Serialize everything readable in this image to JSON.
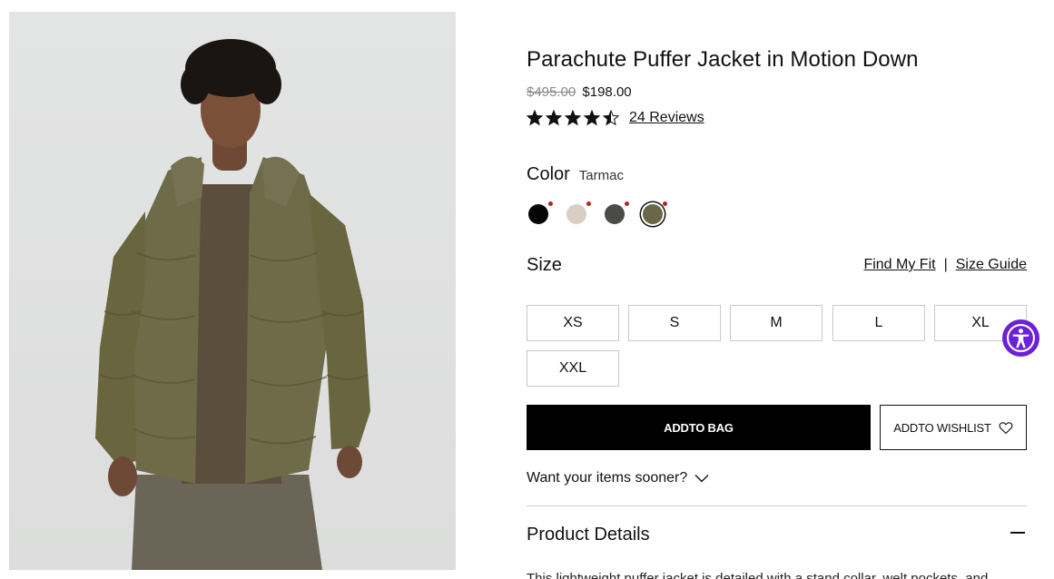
{
  "product": {
    "title": "Parachute Puffer Jacket in Motion Down",
    "price_original": "$495.00",
    "price_sale": "$198.00",
    "rating": 4.5,
    "reviews_label": "24 Reviews",
    "image_icon": "product-photo"
  },
  "color": {
    "label": "Color",
    "selected_name": "Tarmac",
    "swatches": [
      {
        "color": "#050505"
      },
      {
        "color": "#d8cfc2"
      },
      {
        "color": "#4a4a48"
      },
      {
        "color": "#6a6648"
      }
    ],
    "dot_color": "#b3261e"
  },
  "size": {
    "label": "Size",
    "find_fit": "Find My Fit",
    "separator": "|",
    "size_guide": "Size Guide",
    "options": [
      "XS",
      "S",
      "M",
      "L",
      "XL",
      "XXL"
    ]
  },
  "actions": {
    "add_to_bag": "ADDTO BAG",
    "add_to_wishlist": "ADDTO WISHLIST"
  },
  "delivery": {
    "sooner_label": "Want your items sooner?"
  },
  "details": {
    "heading": "Product Details",
    "text": "This lightweight puffer jacket is detailed with a stand collar, welt pockets, and"
  },
  "colors": {
    "accent": "#6b21d6",
    "primary_button": "#000000"
  }
}
